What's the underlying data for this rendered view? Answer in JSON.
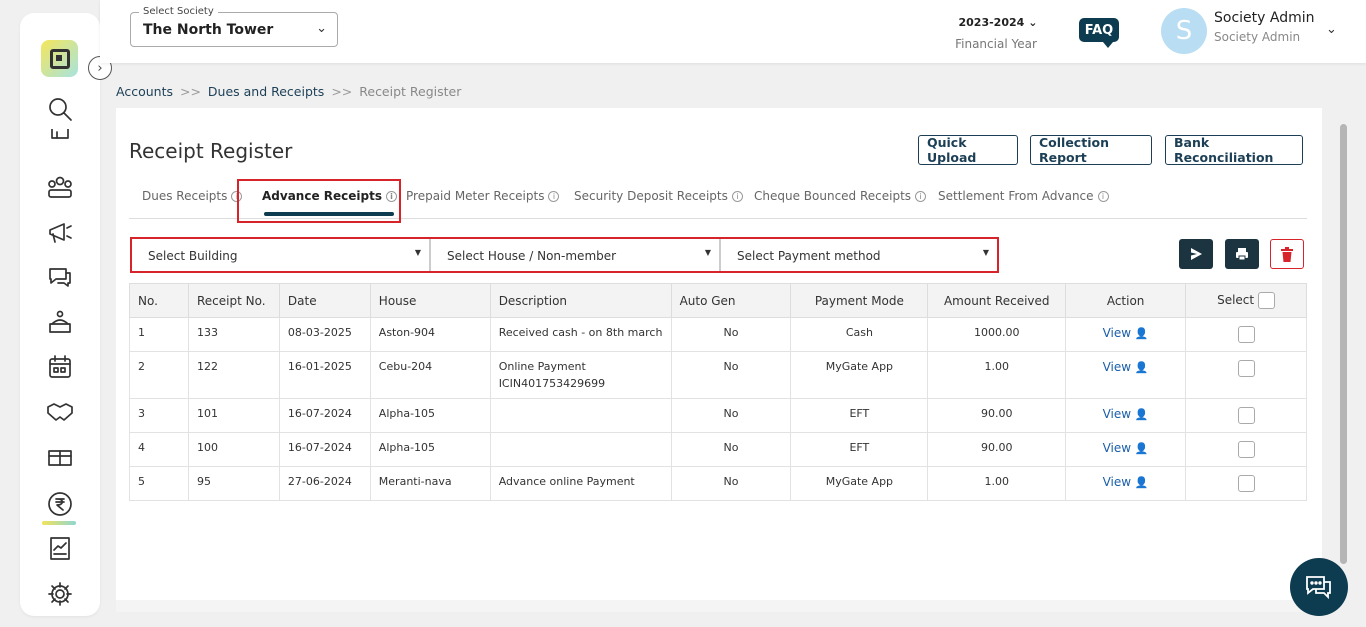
{
  "header": {
    "society_label": "Select Society",
    "society_value": "The North Tower",
    "financial_year": "2023-2024",
    "financial_year_label": "Financial Year",
    "faq": "FAQ",
    "avatar_letter": "S",
    "user_name": "Society Admin",
    "user_role": "Society Admin"
  },
  "breadcrumb": {
    "item1": "Accounts",
    "sep": ">>",
    "item2": "Dues and Receipts",
    "current": "Receipt Register"
  },
  "page": {
    "title": "Receipt Register",
    "buttons": {
      "quick_upload": "Quick Upload",
      "collection_report": "Collection Report",
      "bank_reconciliation": "Bank Reconciliation"
    }
  },
  "tabs": [
    {
      "label": "Dues Receipts"
    },
    {
      "label": "Advance Receipts"
    },
    {
      "label": "Prepaid Meter Receipts"
    },
    {
      "label": "Security Deposit Receipts"
    },
    {
      "label": "Cheque Bounced Receipts"
    },
    {
      "label": "Settlement From Advance"
    }
  ],
  "filters": {
    "building": "Select Building",
    "house": "Select House / Non-member",
    "payment": "Select Payment method"
  },
  "table": {
    "headers": [
      "No.",
      "Receipt No.",
      "Date",
      "House",
      "Description",
      "Auto Gen",
      "Payment Mode",
      "Amount Received",
      "Action",
      "Select"
    ],
    "view_label": "View",
    "rows": [
      {
        "no": "1",
        "receipt": "133",
        "date": "08-03-2025",
        "house": "Aston-904",
        "desc1": "Received cash - on 8th march",
        "desc2": "",
        "auto": "No",
        "mode": "Cash",
        "amount": "1000.00"
      },
      {
        "no": "2",
        "receipt": "122",
        "date": "16-01-2025",
        "house": "Cebu-204",
        "desc1": "Online Payment",
        "desc2": "ICIN401753429699",
        "auto": "No",
        "mode": "MyGate App",
        "amount": "1.00"
      },
      {
        "no": "3",
        "receipt": "101",
        "date": "16-07-2024",
        "house": "Alpha-105",
        "desc1": "",
        "desc2": "",
        "auto": "No",
        "mode": "EFT",
        "amount": "90.00"
      },
      {
        "no": "4",
        "receipt": "100",
        "date": "16-07-2024",
        "house": "Alpha-105",
        "desc1": "",
        "desc2": "",
        "auto": "No",
        "mode": "EFT",
        "amount": "90.00"
      },
      {
        "no": "5",
        "receipt": "95",
        "date": "27-06-2024",
        "house": "Meranti-nava",
        "desc1": "Advance online Payment",
        "desc2": "",
        "auto": "No",
        "mode": "MyGate App",
        "amount": "1.00"
      }
    ]
  },
  "colors": {
    "brand_dark": "#0d3b4f",
    "highlight_red": "#d7232a",
    "link_blue": "#1a5ea8"
  }
}
